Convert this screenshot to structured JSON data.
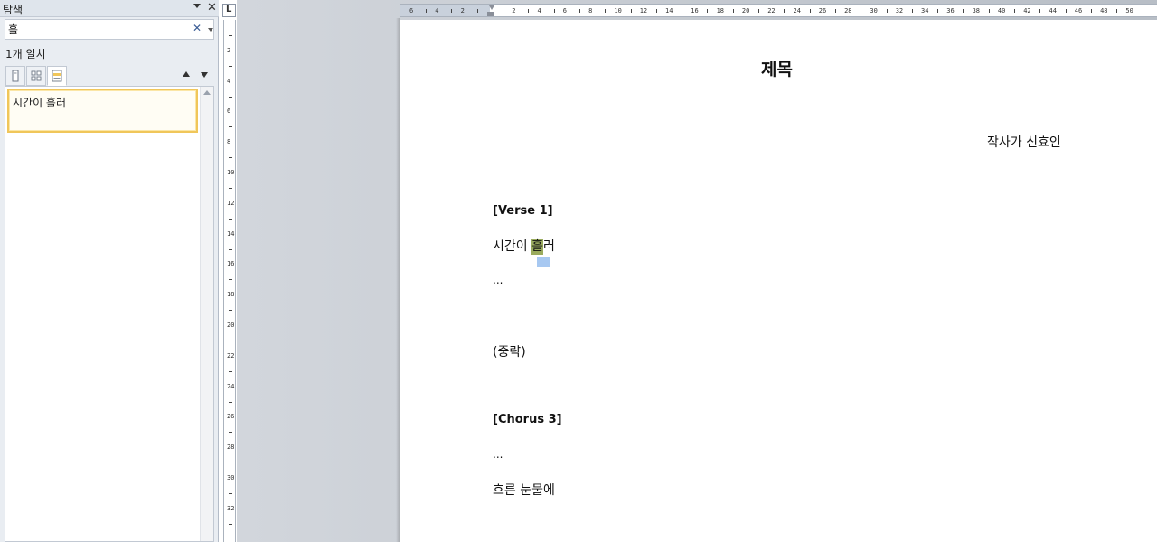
{
  "nav_pane": {
    "title": "탐색",
    "search": {
      "value": "흘",
      "placeholder": ""
    },
    "match_count": "1개 일치",
    "tabs": [
      {
        "name": "headings",
        "icon": "page-thumbnail-icon"
      },
      {
        "name": "pages",
        "icon": "grid-icon"
      },
      {
        "name": "results",
        "icon": "document-results-icon",
        "active": true
      }
    ],
    "results": [
      {
        "text": "시간이 흘러"
      }
    ],
    "colors": {
      "selected_border": "#f0c65a",
      "pane_background": "#e9edf2"
    }
  },
  "rulers": {
    "corner_label": "L",
    "horizontal": [
      "6",
      "4",
      "2",
      "",
      "2",
      "4",
      "6",
      "8",
      "10",
      "12",
      "14",
      "16",
      "18",
      "20",
      "22",
      "24",
      "26",
      "28",
      "30",
      "32",
      "34",
      "36",
      "38",
      "40",
      "42",
      "44",
      "46",
      "48",
      "50"
    ],
    "vertical": [
      "",
      "2",
      "4",
      "6",
      "8",
      "10",
      "12",
      "14",
      "16",
      "18",
      "20",
      "22",
      "24",
      "26",
      "28",
      "30",
      "32"
    ]
  },
  "document": {
    "title": "제목",
    "author": "작사가 신효인",
    "verse1": {
      "header": "[Verse  1]",
      "line_before": "시간이 ",
      "line_match": "흘",
      "line_after": "러",
      "ellipsis": "..."
    },
    "interlude": "(중략)",
    "chorus3": {
      "header": "[Chorus  3]",
      "ellipsis": "...",
      "line": "흐른  눈물에"
    },
    "colors": {
      "match_highlight": "#9aab5e",
      "selection": "#a7c8f1"
    }
  }
}
